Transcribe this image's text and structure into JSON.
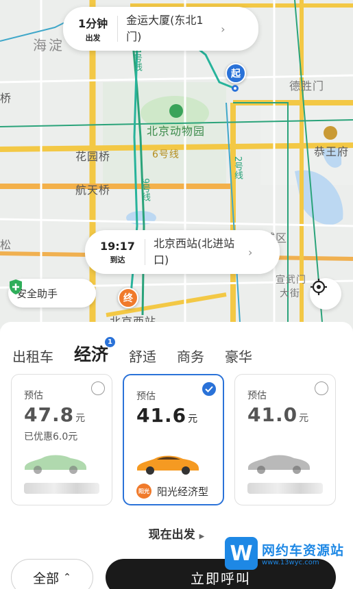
{
  "map": {
    "labels": {
      "haidian": "海淀",
      "qiao": "桥",
      "zoo": "北京动物园",
      "line4a": "4号线",
      "line6": "6号线",
      "line9": "9号线",
      "line2": "2号线",
      "deshengmen": "德胜门",
      "gongwangfu": "恭王府",
      "huayuanqiao": "花园桥",
      "hangtianqiao": "航天桥",
      "song": "松",
      "cheng_district": "城区",
      "xuanwumen": "宣武门",
      "dajie": "大街",
      "bjxz": "北京西站"
    },
    "start_marker": "起",
    "end_marker": "终"
  },
  "pickup": {
    "time": "1分钟",
    "time_sub": "出发",
    "place": "金运大厦(东北1门)"
  },
  "arrive": {
    "time": "19:17",
    "time_sub": "到达",
    "place": "北京西站(北进站口)"
  },
  "safety_label": "安全助手",
  "tabs": [
    {
      "label": "出租车"
    },
    {
      "label": "经济",
      "badge": "1"
    },
    {
      "label": "舒适"
    },
    {
      "label": "商务"
    },
    {
      "label": "豪华"
    }
  ],
  "cards": [
    {
      "est": "预估",
      "price": "47.8",
      "unit": "元",
      "discount": "已优惠6.0元",
      "car_color": "#9ccf9a"
    },
    {
      "est": "预估",
      "price": "41.6",
      "unit": "元",
      "brand_logo": "阳光",
      "brand": "阳光经济型",
      "car_color": "#f59a22"
    },
    {
      "est": "预估",
      "price": "41.0",
      "unit": "元",
      "car_color": "#9b9b9b"
    }
  ],
  "depart_now": "现在出发",
  "btn_all": "全部",
  "btn_call": "立即呼叫",
  "watermark": {
    "logo": "W",
    "title": "网约车资源站",
    "url": "www.13wyc.com"
  },
  "colors": {
    "accent": "#2a72d8",
    "end_marker": "#f07a2b",
    "metro_green": "#2aa37a",
    "road_yellow": "#f2c23a"
  }
}
